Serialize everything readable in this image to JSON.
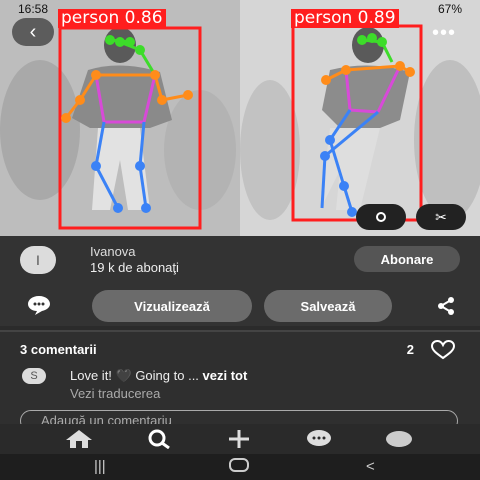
{
  "status_bar": {
    "time": "16:58",
    "battery": "67%"
  },
  "detections": [
    {
      "label": "person 0.86"
    },
    {
      "label": "person 0.89"
    }
  ],
  "photo_icons": {
    "back": "back-arrow-icon",
    "more": "more-icon",
    "lens": "lens-icon",
    "scissors": "scissors-icon"
  },
  "user": {
    "avatar_letter": "I",
    "name": "Ivanova",
    "followers": "19 k de abonaţi",
    "follow_label": "Abonare"
  },
  "actions": {
    "view_label": "Vizualizează",
    "save_label": "Salvează"
  },
  "comments": {
    "title": "3 comentarii",
    "likes": "2",
    "first": {
      "avatar_letter": "S",
      "text": "Love it! 🖤 Going to ...",
      "more": "vezi tot",
      "translate": "Vezi traducerea"
    },
    "add_placeholder": "Adaugă un comentariu"
  },
  "bottom_nav": [
    "home-icon",
    "search-icon",
    "plus-icon",
    "chat-icon",
    "profile-icon"
  ],
  "system_nav": [
    "recents",
    "home",
    "back"
  ],
  "colors": {
    "detection_box": "#ff1e1e",
    "keypoint_head": "#3ddc2a",
    "keypoint_arms": "#ff8c1a",
    "keypoint_torso": "#d84ad8",
    "keypoint_legs": "#3b82f6"
  }
}
